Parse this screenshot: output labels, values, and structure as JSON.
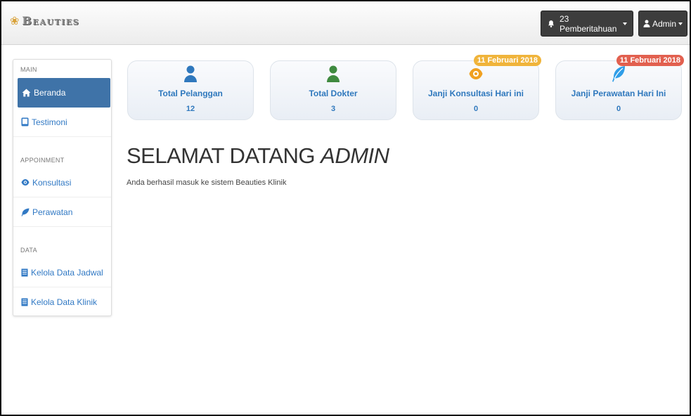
{
  "brand": {
    "name": "Beauties",
    "icon": "lotus-icon"
  },
  "navbar": {
    "notifications_label": "23 Pemberitahuan",
    "user_label": "Admin"
  },
  "sidebar": {
    "sections": [
      {
        "heading": "MAIN",
        "items": [
          {
            "label": "Beranda",
            "icon": "home-icon",
            "active": true
          },
          {
            "label": "Testimoni",
            "icon": "tablet-icon"
          }
        ]
      },
      {
        "heading": "APPOINMENT",
        "items": [
          {
            "label": "Konsultasi",
            "icon": "eye-icon"
          },
          {
            "label": "Perawatan",
            "icon": "leaf-icon"
          }
        ]
      },
      {
        "heading": "DATA",
        "items": [
          {
            "label": "Kelola Data Jadwal",
            "icon": "list-icon"
          },
          {
            "label": "Kelola Data Klinik",
            "icon": "list-icon"
          }
        ]
      }
    ]
  },
  "cards": [
    {
      "title": "Total Pelanggan",
      "value": "12",
      "icon": "user-icon",
      "icon_color": "#2f78bd"
    },
    {
      "title": "Total Dokter",
      "value": "3",
      "icon": "user-icon",
      "icon_color": "#3f8a3f"
    },
    {
      "title": "Janji Konsultasi Hari ini",
      "value": "0",
      "icon": "eye-icon",
      "icon_color": "#f0a020",
      "badge": "11 Februari 2018",
      "badge_color": "#f0b43b"
    },
    {
      "title": "Janji Perawatan Hari Ini",
      "value": "0",
      "icon": "leaf-icon",
      "icon_color": "#2f9ee8",
      "badge": "11 Februari 2018",
      "badge_color": "#e2604f"
    }
  ],
  "main": {
    "welcome_prefix": "SELAMAT DATANG ",
    "welcome_name": "ADMIN",
    "subtext": "Anda berhasil masuk ke sistem Beauties Klinik"
  }
}
